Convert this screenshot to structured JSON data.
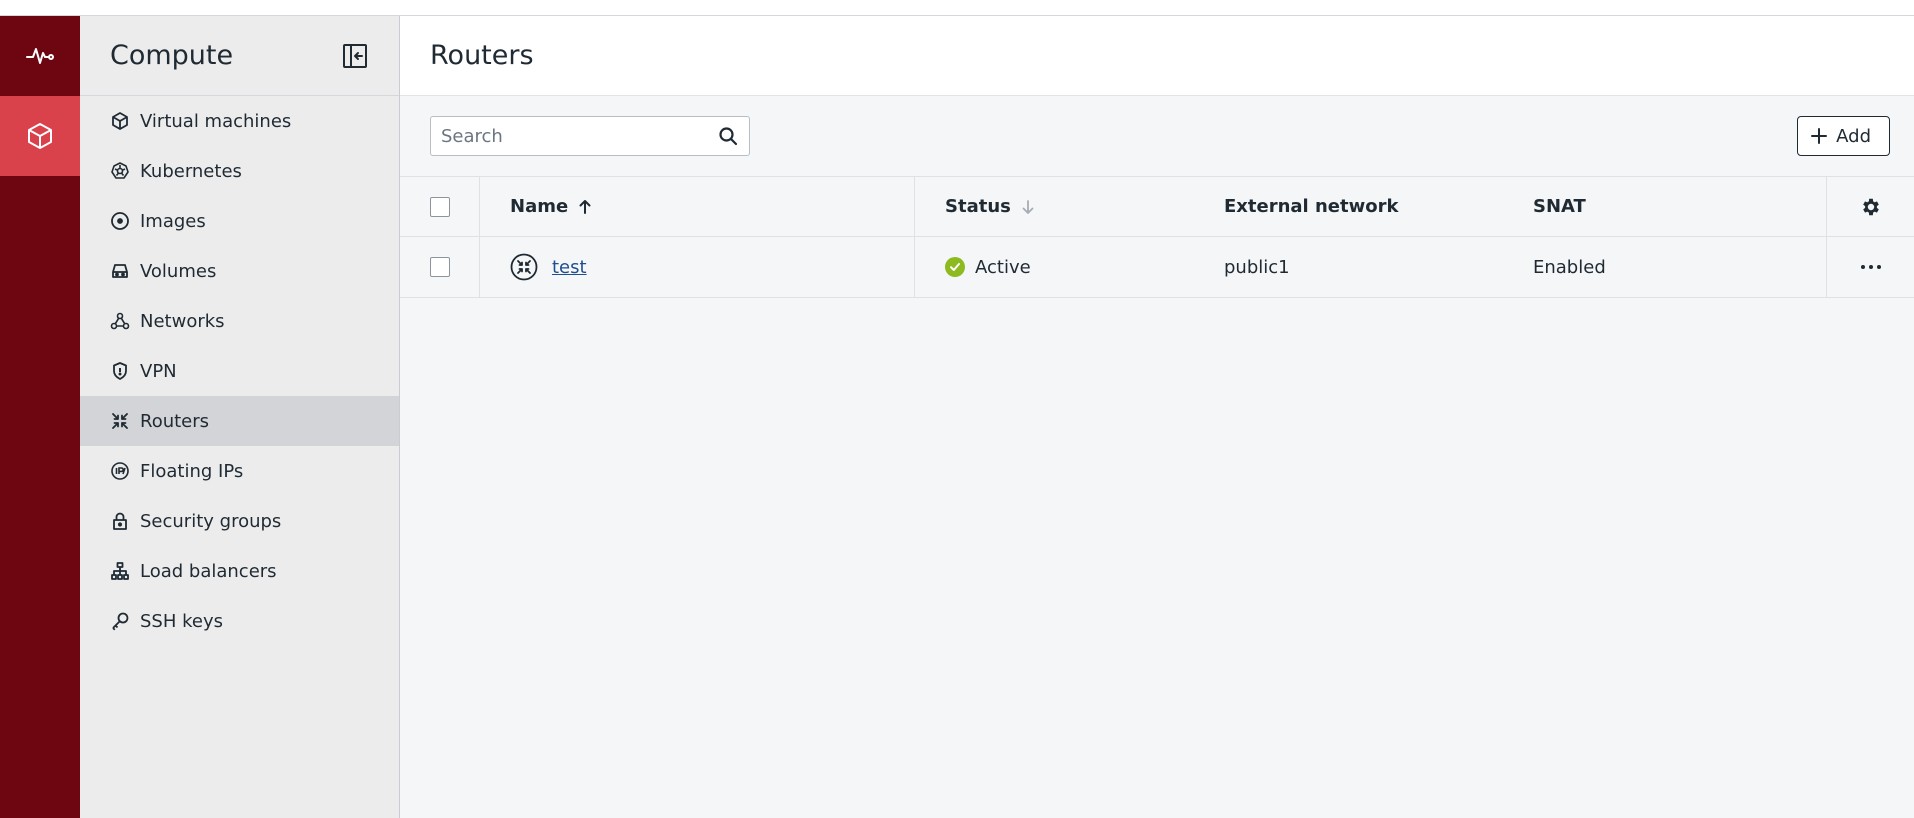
{
  "colors": {
    "rail": "#6e0612",
    "rail_active": "#d9414b",
    "sidebar_bg": "#ececed",
    "sidebar_selected": "#d2d4d7",
    "status_active": "#8dbb1f",
    "link": "#1d4f91"
  },
  "rail": {
    "items": [
      {
        "icon": "activity-pulse-icon",
        "active": false
      },
      {
        "icon": "cube-icon",
        "active": true
      }
    ]
  },
  "sidebar": {
    "title": "Compute",
    "collapse_icon": "collapse-sidebar-icon",
    "items": [
      {
        "label": "Virtual machines",
        "icon": "cube-icon"
      },
      {
        "label": "Kubernetes",
        "icon": "kubernetes-wheel-icon"
      },
      {
        "label": "Images",
        "icon": "disc-icon"
      },
      {
        "label": "Volumes",
        "icon": "hard-drive-icon"
      },
      {
        "label": "Networks",
        "icon": "network-nodes-icon"
      },
      {
        "label": "VPN",
        "icon": "shield-icon"
      },
      {
        "label": "Routers",
        "icon": "router-arrows-icon",
        "selected": true
      },
      {
        "label": "Floating IPs",
        "icon": "floating-ip-icon"
      },
      {
        "label": "Security groups",
        "icon": "lock-icon"
      },
      {
        "label": "Load balancers",
        "icon": "hierarchy-icon"
      },
      {
        "label": "SSH keys",
        "icon": "key-icon"
      }
    ]
  },
  "main": {
    "title": "Routers",
    "search": {
      "placeholder": "Search",
      "icon": "search-icon"
    },
    "add_label": "Add",
    "table": {
      "columns": {
        "name": "Name",
        "status": "Status",
        "external_network": "External network",
        "snat": "SNAT"
      },
      "sort": {
        "name": "ascending",
        "status": "descending-inactive"
      },
      "rows": [
        {
          "name": "test",
          "status": "Active",
          "external_network": "public1",
          "snat": "Enabled"
        }
      ]
    }
  }
}
